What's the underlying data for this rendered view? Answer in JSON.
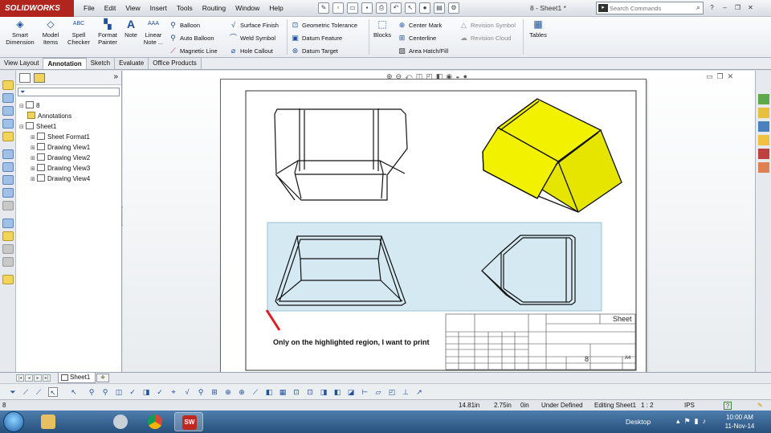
{
  "app": {
    "logo_text": "SOLIDWORKS",
    "document_title": "8 - Sheet1 *"
  },
  "menu": [
    "File",
    "Edit",
    "View",
    "Insert",
    "Tools",
    "Routing",
    "Window",
    "Help"
  ],
  "search": {
    "placeholder": "Search Commands"
  },
  "ribbon": {
    "smart_dimension": "Smart\nDimension",
    "model_items": "Model\nItems",
    "spell_checker": "Spell\nChecker",
    "format_painter": "Format\nPainter",
    "note": "Note",
    "linear_note": "Linear\nNote ...",
    "balloon": "Balloon",
    "auto_balloon": "Auto Balloon",
    "magnetic_line": "Magnetic Line",
    "surface_finish": "Surface Finish",
    "weld_symbol": "Weld Symbol",
    "hole_callout": "Hole Callout",
    "geometric_tolerance": "Geometric Tolerance",
    "datum_feature": "Datum Feature",
    "datum_target": "Datum Target",
    "blocks": "Blocks",
    "center_mark": "Center Mark",
    "centerline": "Centerline",
    "area_hatch": "Area Hatch/Fill",
    "revision_symbol": "Revision Symbol",
    "revision_cloud": "Revision Cloud",
    "tables": "Tables"
  },
  "command_tabs": [
    {
      "label": "View Layout",
      "active": false
    },
    {
      "label": "Annotation",
      "active": true
    },
    {
      "label": "Sketch",
      "active": false
    },
    {
      "label": "Evaluate",
      "active": false
    },
    {
      "label": "Office Products",
      "active": false
    }
  ],
  "tree": {
    "root": "8",
    "annotations": "Annotations",
    "sheet": "Sheet1",
    "sheet_format": "Sheet Format1",
    "views": [
      "Drawing View1",
      "Drawing View2",
      "Drawing View3",
      "Drawing View4"
    ]
  },
  "drawing": {
    "annotation_text": "Only on the highlighted region, I want to print",
    "title_block_sheet": "Sheet",
    "title_block_number": "8",
    "title_block_size": "A4",
    "highlight_color": "#d5e9f2",
    "iso_color": "#f2f200",
    "arrow_color": "#e01b24"
  },
  "sheet_tabs": {
    "active": "Sheet1"
  },
  "status": {
    "left": "8",
    "x": "14.81in",
    "y": "2.75in",
    "z": "0in",
    "state": "Under Defined",
    "editing": "Editing Sheet1",
    "scale": "1 : 2",
    "units": "IPS",
    "help": "?"
  },
  "taskbar": {
    "desktop": "Desktop",
    "time": "10:00 AM",
    "date": "11-Nov-14"
  }
}
